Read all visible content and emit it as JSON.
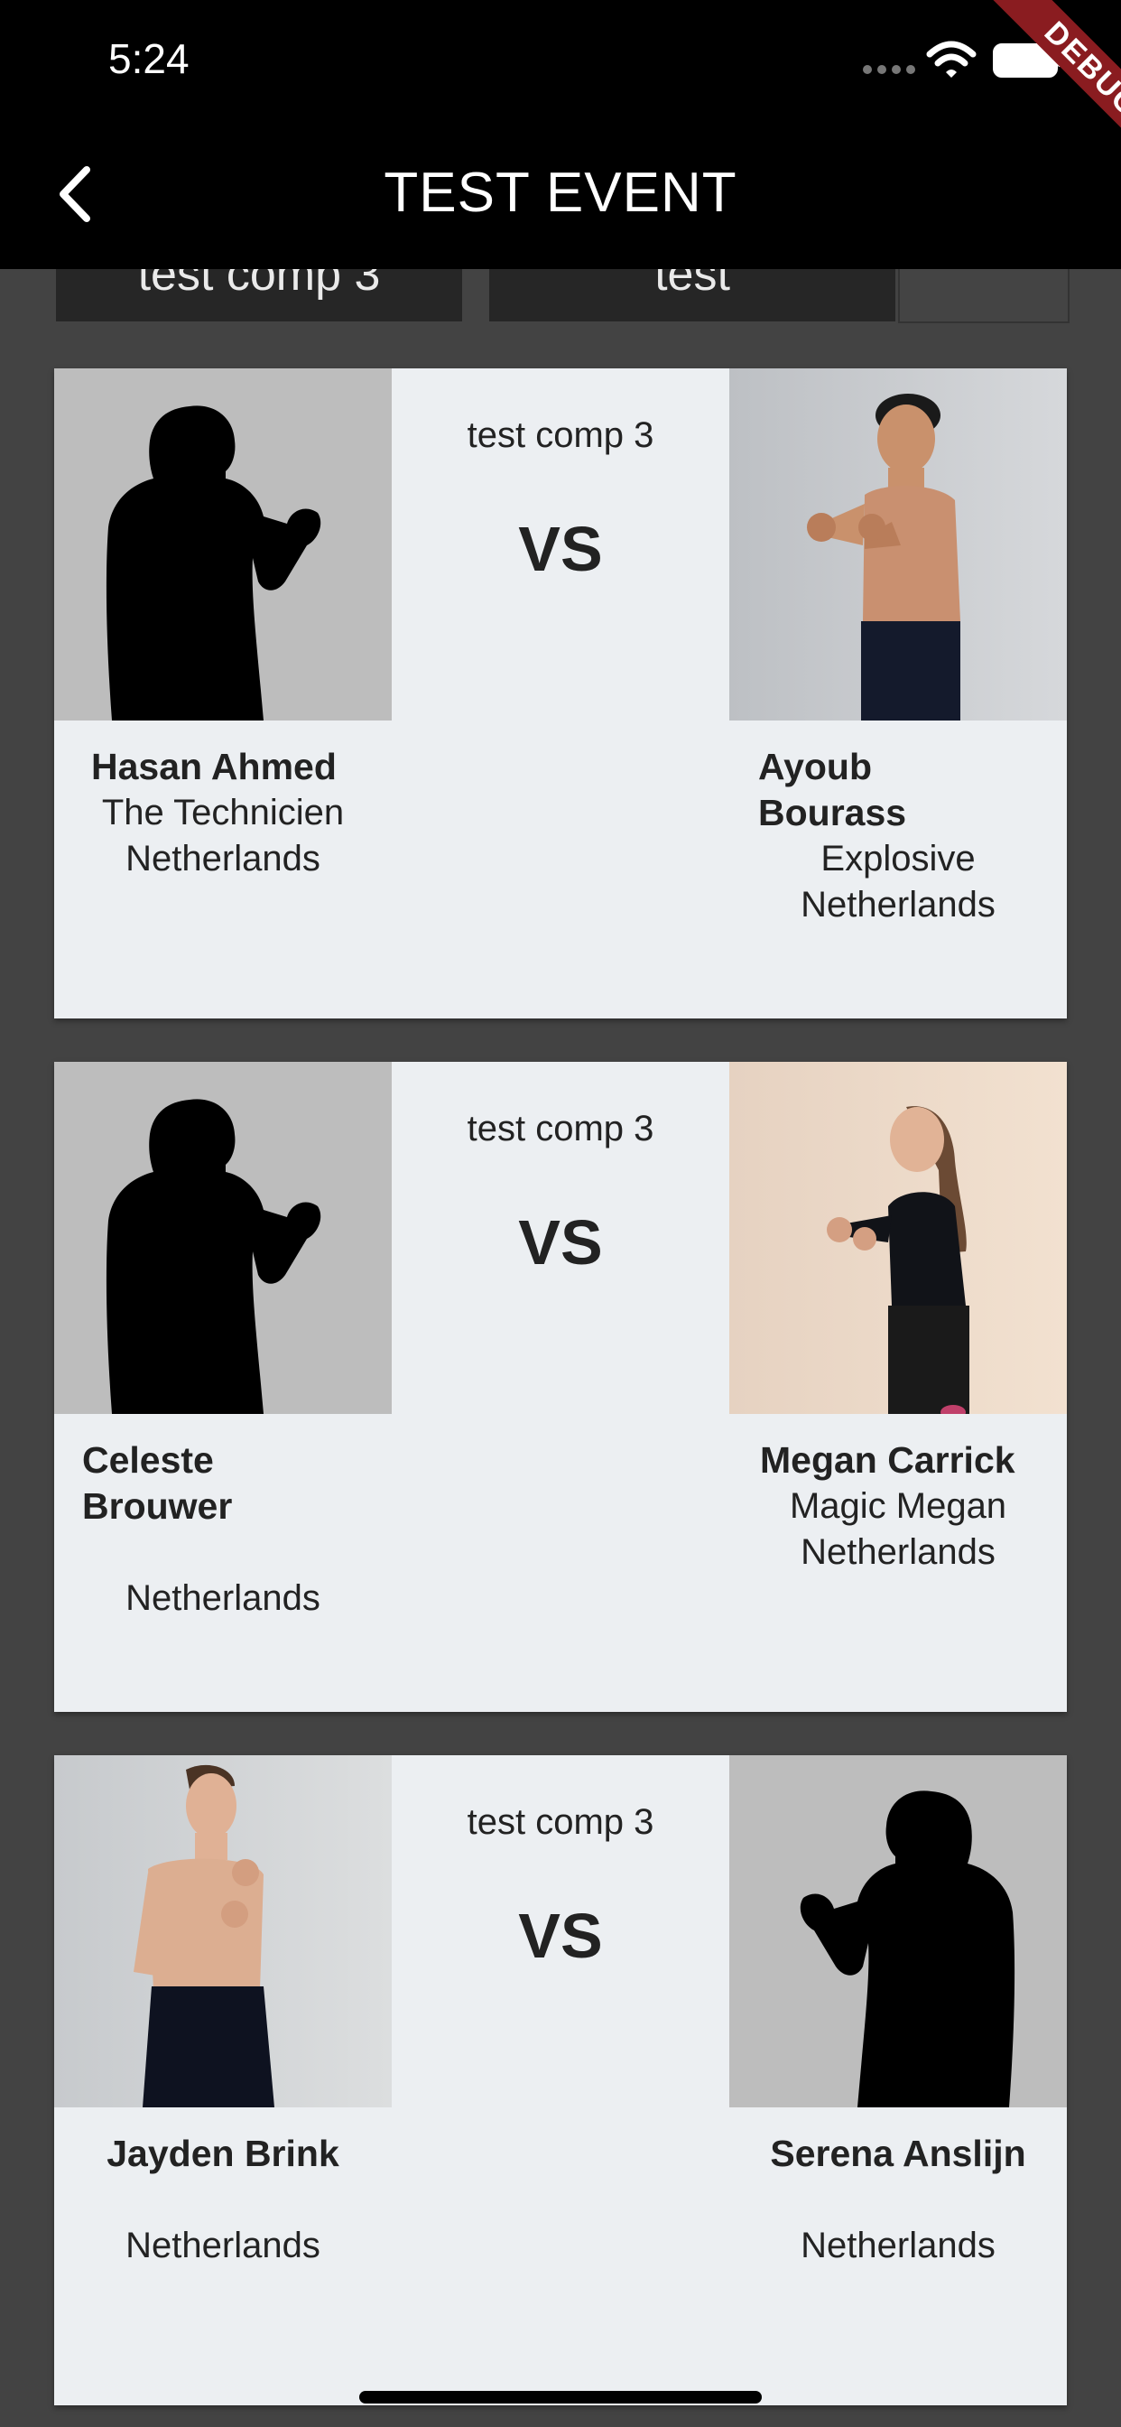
{
  "status": {
    "time": "5:24",
    "debug_banner": "DEBUG"
  },
  "appbar": {
    "title": "TEST EVENT"
  },
  "tabs": [
    {
      "label": "test comp 3"
    },
    {
      "label": "test"
    }
  ],
  "fights": [
    {
      "competition": "test comp 3",
      "vs": "VS",
      "left": {
        "name": "Hasan Ahmed",
        "nickname": "The Technicien",
        "country": "Netherlands",
        "photo": "silhouette"
      },
      "right": {
        "name": "Ayoub Bourass",
        "nickname": "Explosive",
        "country": "Netherlands",
        "photo": "fighter-photo"
      }
    },
    {
      "competition": "test comp 3",
      "vs": "VS",
      "left": {
        "name": "Celeste Brouwer",
        "nickname": "",
        "country": "Netherlands",
        "photo": "silhouette"
      },
      "right": {
        "name": "Megan Carrick",
        "nickname": "Magic Megan",
        "country": "Netherlands",
        "photo": "fighter-photo"
      }
    },
    {
      "competition": "test comp 3",
      "vs": "VS",
      "left": {
        "name": "Jayden Brink",
        "nickname": "",
        "country": "Netherlands",
        "photo": "fighter-photo"
      },
      "right": {
        "name": "Serena Anslijn",
        "nickname": "",
        "country": "Netherlands",
        "photo": "silhouette"
      }
    }
  ],
  "colors": {
    "background": "#434343",
    "card": "#eceff2",
    "appbar": "#000000",
    "debug": "#8a1c20"
  }
}
